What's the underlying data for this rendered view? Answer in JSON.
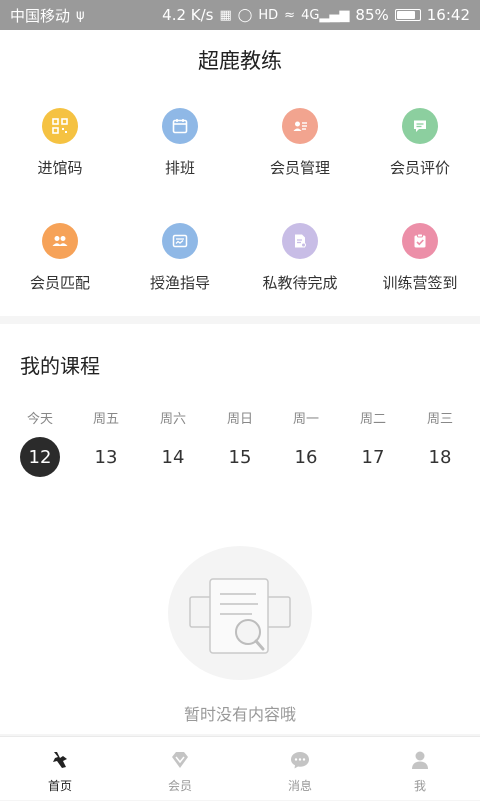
{
  "status_bar": {
    "carrier": "中国移动",
    "speed": "4.2 K/s",
    "battery_text": "85%",
    "battery_level": 0.85,
    "time": "16:42",
    "signal_label": "4G"
  },
  "header": {
    "title": "超鹿教练"
  },
  "features": [
    {
      "label": "进馆码",
      "icon": "qr-code-icon",
      "color": "#f5c242"
    },
    {
      "label": "排班",
      "icon": "calendar-icon",
      "color": "#8fb8e6"
    },
    {
      "label": "会员管理",
      "icon": "member-card-icon",
      "color": "#f2a48f"
    },
    {
      "label": "会员评价",
      "icon": "comment-icon",
      "color": "#8ccf9f"
    },
    {
      "label": "会员匹配",
      "icon": "users-icon",
      "color": "#f6a258"
    },
    {
      "label": "授渔指导",
      "icon": "guide-card-icon",
      "color": "#8fb8e6"
    },
    {
      "label": "私教待完成",
      "icon": "document-icon",
      "color": "#c8bde6"
    },
    {
      "label": "训练营签到",
      "icon": "checkin-icon",
      "color": "#ec8fa8"
    }
  ],
  "courses": {
    "title": "我的课程",
    "days": [
      {
        "name": "今天",
        "num": "12",
        "active": true
      },
      {
        "name": "周五",
        "num": "13",
        "active": false
      },
      {
        "name": "周六",
        "num": "14",
        "active": false
      },
      {
        "name": "周日",
        "num": "15",
        "active": false
      },
      {
        "name": "周一",
        "num": "16",
        "active": false
      },
      {
        "name": "周二",
        "num": "17",
        "active": false
      },
      {
        "name": "周三",
        "num": "18",
        "active": false
      }
    ],
    "empty_text": "暂时没有内容哦"
  },
  "tabs": [
    {
      "label": "首页",
      "icon": "home-deer-icon",
      "active": true
    },
    {
      "label": "会员",
      "icon": "diamond-icon",
      "active": false
    },
    {
      "label": "消息",
      "icon": "chat-icon",
      "active": false
    },
    {
      "label": "我",
      "icon": "person-icon",
      "active": false
    }
  ]
}
